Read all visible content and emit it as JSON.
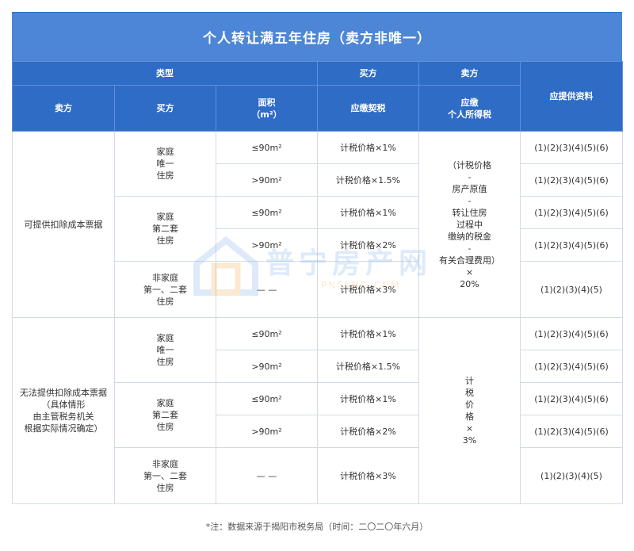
{
  "title": "个人转让满五年住房（卖方非唯一）",
  "header": {
    "type": "类型",
    "buyer_group": "买方",
    "seller_group": "卖方",
    "docs": "应提供资料",
    "seller": "卖方",
    "buyer": "买方",
    "area": "面积\n（m²）",
    "deed_tax": "应缴契税",
    "income_tax": "应缴\n个人所得税"
  },
  "groups": [
    {
      "seller": "可提供扣除成本票据",
      "income_tax": "（计税价格\n-\n房产原值\n-\n转让住房\n过程中\n缴纳的税金\n-\n有关合理费用）\n×\n20%",
      "buyers": [
        {
          "label": "家庭\n唯一\n住房",
          "rows": [
            {
              "area": "≤90m²",
              "deed": "计税价格×1%",
              "docs": "(1)(2)(3)(4)(5)(6)"
            },
            {
              "area": ">90m²",
              "deed": "计税价格×1.5%",
              "docs": "(1)(2)(3)(4)(5)(6)"
            }
          ]
        },
        {
          "label": "家庭\n第二套\n住房",
          "rows": [
            {
              "area": "≤90m²",
              "deed": "计税价格×1%",
              "docs": "(1)(2)(3)(4)(5)(6)"
            },
            {
              "area": ">90m²",
              "deed": "计税价格×2%",
              "docs": "(1)(2)(3)(4)(5)(6)"
            }
          ]
        },
        {
          "label": "非家庭\n第一、二套\n住房",
          "rows": [
            {
              "area": "— —",
              "deed": "计税价格×3%",
              "docs": "(1)(2)(3)(4)(5)"
            }
          ]
        }
      ]
    },
    {
      "seller": "无法提供扣除成本票据\n（具体情形\n由主管税务机关\n根据实际情况确定）",
      "income_tax": "计\n税\n价\n格\n×\n3%",
      "buyers": [
        {
          "label": "家庭\n唯一\n住房",
          "rows": [
            {
              "area": "≤90m²",
              "deed": "计税价格×1%",
              "docs": "(1)(2)(3)(4)(5)(6)"
            },
            {
              "area": ">90m²",
              "deed": "计税价格×1.5%",
              "docs": "(1)(2)(3)(4)(5)(6)"
            }
          ]
        },
        {
          "label": "家庭\n第二套\n住房",
          "rows": [
            {
              "area": "≤90m²",
              "deed": "计税价格×1%",
              "docs": "(1)(2)(3)(4)(5)(6)"
            },
            {
              "area": ">90m²",
              "deed": "计税价格×2%",
              "docs": "(1)(2)(3)(4)(5)(6)"
            }
          ]
        },
        {
          "label": "非家庭\n第一、二套\n住房",
          "rows": [
            {
              "area": "— —",
              "deed": "计税价格×3%",
              "docs": "(1)(2)(3)(4)(5)"
            }
          ]
        }
      ]
    }
  ],
  "note": "*注：数据来源于揭阳市税务局（时间：二〇二〇年六月）",
  "watermark": {
    "brand": "普宁房产网",
    "site": "PNFANG.COM"
  }
}
